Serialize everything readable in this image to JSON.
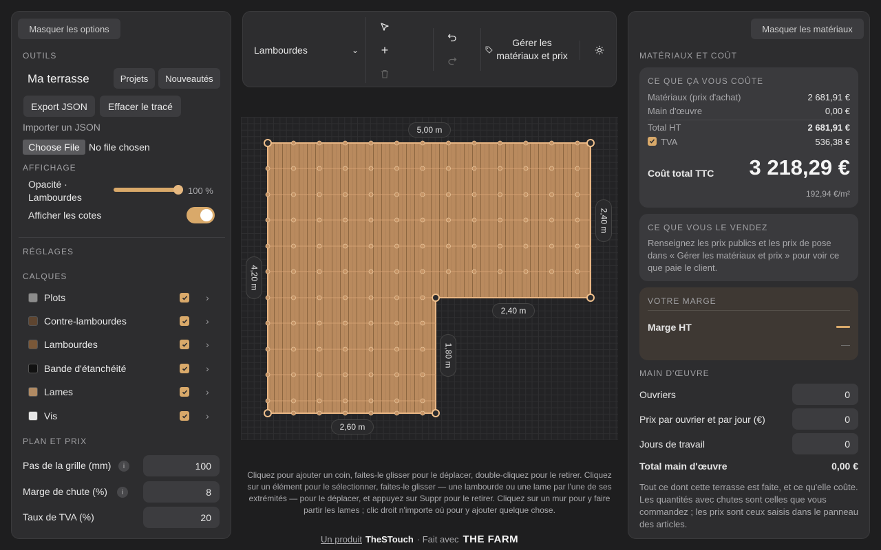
{
  "left": {
    "hide_options": "Masquer les options",
    "tools_title": "OUTILS",
    "project_name": "Ma terrasse",
    "projects_btn": "Projets",
    "news_btn": "Nouveautés",
    "export_btn": "Export JSON",
    "clear_btn": "Effacer le tracé",
    "import_label": "Importer un JSON",
    "choose_file": "Choose File",
    "no_file": "No file chosen",
    "display_title": "AFFICHAGE",
    "opacity_label": "Opacité · Lambourdes",
    "opacity_value": "100 %",
    "opacity_fraction": 1.0,
    "show_dims_label": "Afficher les cotes",
    "show_dims_on": true,
    "settings_title": "RÉGLAGES",
    "layers_title": "CALQUES",
    "layers": [
      {
        "label": "Plots",
        "color": "#8c8c8c",
        "checked": true
      },
      {
        "label": "Contre-lambourdes",
        "color": "#5e4530",
        "checked": true
      },
      {
        "label": "Lambourdes",
        "color": "#7a5838",
        "checked": true
      },
      {
        "label": "Bande d'étanchéité",
        "color": "#111111",
        "checked": true
      },
      {
        "label": "Lames",
        "color": "#b08a63",
        "checked": true
      },
      {
        "label": "Vis",
        "color": "#e6e6e6",
        "checked": true
      }
    ],
    "plan_title": "PLAN ET PRIX",
    "grid_label": "Pas de la grille (mm)",
    "grid_value": "100",
    "waste_label": "Marge de chute (%)",
    "waste_value": "8",
    "vat_label": "Taux de TVA (%)",
    "vat_value": "20"
  },
  "toolbar": {
    "select_value": "Lambourdes",
    "manage_label": "Gérer les matériaux et prix"
  },
  "canvas": {
    "dims": {
      "top": "5,00 m",
      "right": "2,40 m",
      "left": "4,20 m",
      "inner_h": "2,40 m",
      "inner_v": "1,80 m",
      "bottom": "2,60 m"
    },
    "help": "Cliquez pour ajouter un coin, faites-le glisser pour le déplacer, double-cliquez pour le retirer. Cliquez sur un élément pour le sélectionner, faites-le glisser — une lambourde ou une lame par l'une de ses extrémités — pour le déplacer, et appuyez sur Suppr pour le retirer. Cliquez sur un mur pour y faire partir les lames ; clic droit n'importe où pour y ajouter quelque chose."
  },
  "footer": {
    "product": "Un produit",
    "brand": "TheSTouch",
    "made_with": "· Fait avec",
    "farm": "THE FARM"
  },
  "right": {
    "hide_materials": "Masquer les matériaux",
    "title": "MATÉRIAUX ET COÛT",
    "cost_card": {
      "title": "CE QUE ÇA VOUS COÛTE",
      "materials_label": "Matériaux (prix d'achat)",
      "materials_value": "2 681,91 €",
      "labor_label": "Main d'œuvre",
      "labor_value": "0,00 €",
      "total_ht_label": "Total HT",
      "total_ht_value": "2 681,91 €",
      "vat_label": "TVA",
      "vat_value": "536,38 €",
      "ttc_label": "Coût total TTC",
      "ttc_value": "3 218,29 €",
      "per_m2": "192,94 €/m²"
    },
    "sell_card": {
      "title": "CE QUE VOUS LE VENDEZ",
      "text": "Renseignez les prix publics et les prix de pose dans « Gérer les matériaux et prix » pour voir ce que paie le client."
    },
    "margin_card": {
      "title": "VOTRE MARGE",
      "label": "Marge HT",
      "dash": "—"
    },
    "labor": {
      "title": "MAIN D'ŒUVRE",
      "workers_label": "Ouvriers",
      "workers_value": "0",
      "price_label": "Prix par ouvrier et par jour (€)",
      "price_value": "0",
      "days_label": "Jours de travail",
      "days_value": "0",
      "total_label": "Total main d'œuvre",
      "total_value": "0,00 €",
      "note": "Tout ce dont cette terrasse est faite, et ce qu'elle coûte. Les quantités avec chutes sont celles que vous commandez ; les prix sont ceux saisis dans le panneau des articles."
    }
  },
  "colors": {
    "accent": "#d9a96a",
    "deck": "#b98a5e"
  }
}
